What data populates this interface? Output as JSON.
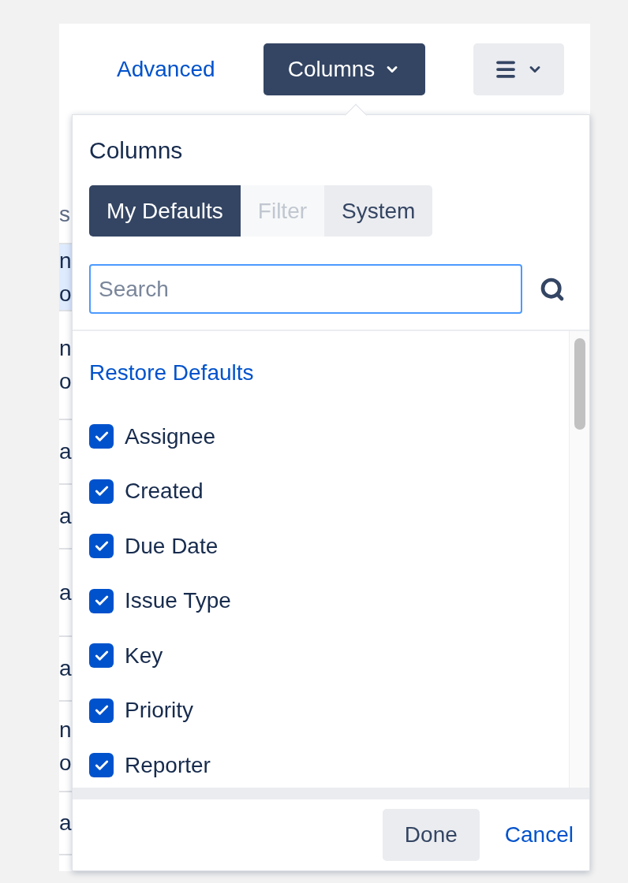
{
  "toolbar": {
    "advanced_link": "Advanced",
    "columns_button": {
      "label": "Columns",
      "expanded": true
    }
  },
  "table": {
    "header": "s",
    "rows": [
      {
        "lines": [
          "n",
          "o"
        ],
        "selected": true
      },
      {
        "lines": [
          "n",
          "o"
        ],
        "selected": false
      },
      {
        "lines": [
          "a"
        ],
        "selected": false
      },
      {
        "lines": [
          "a"
        ],
        "selected": false
      },
      {
        "lines": [
          "a"
        ],
        "selected": false
      },
      {
        "lines": [
          "a"
        ],
        "selected": false
      },
      {
        "lines": [
          "n",
          "o"
        ],
        "selected": false
      },
      {
        "lines": [
          "a"
        ],
        "selected": false
      }
    ]
  },
  "columns_popup": {
    "title": "Columns",
    "tabs": [
      {
        "label": "My Defaults",
        "selected": true,
        "disabled": false
      },
      {
        "label": "Filter",
        "selected": false,
        "disabled": true
      },
      {
        "label": "System",
        "selected": false,
        "disabled": false
      }
    ],
    "search": {
      "placeholder": "Search"
    },
    "restore_link": "Restore Defaults",
    "items": [
      {
        "label": "Assignee",
        "checked": true
      },
      {
        "label": "Created",
        "checked": true
      },
      {
        "label": "Due Date",
        "checked": true
      },
      {
        "label": "Issue Type",
        "checked": true
      },
      {
        "label": "Key",
        "checked": true
      },
      {
        "label": "Priority",
        "checked": true
      },
      {
        "label": "Reporter",
        "checked": true
      }
    ],
    "buttons": {
      "done": "Done",
      "cancel": "Cancel"
    }
  }
}
